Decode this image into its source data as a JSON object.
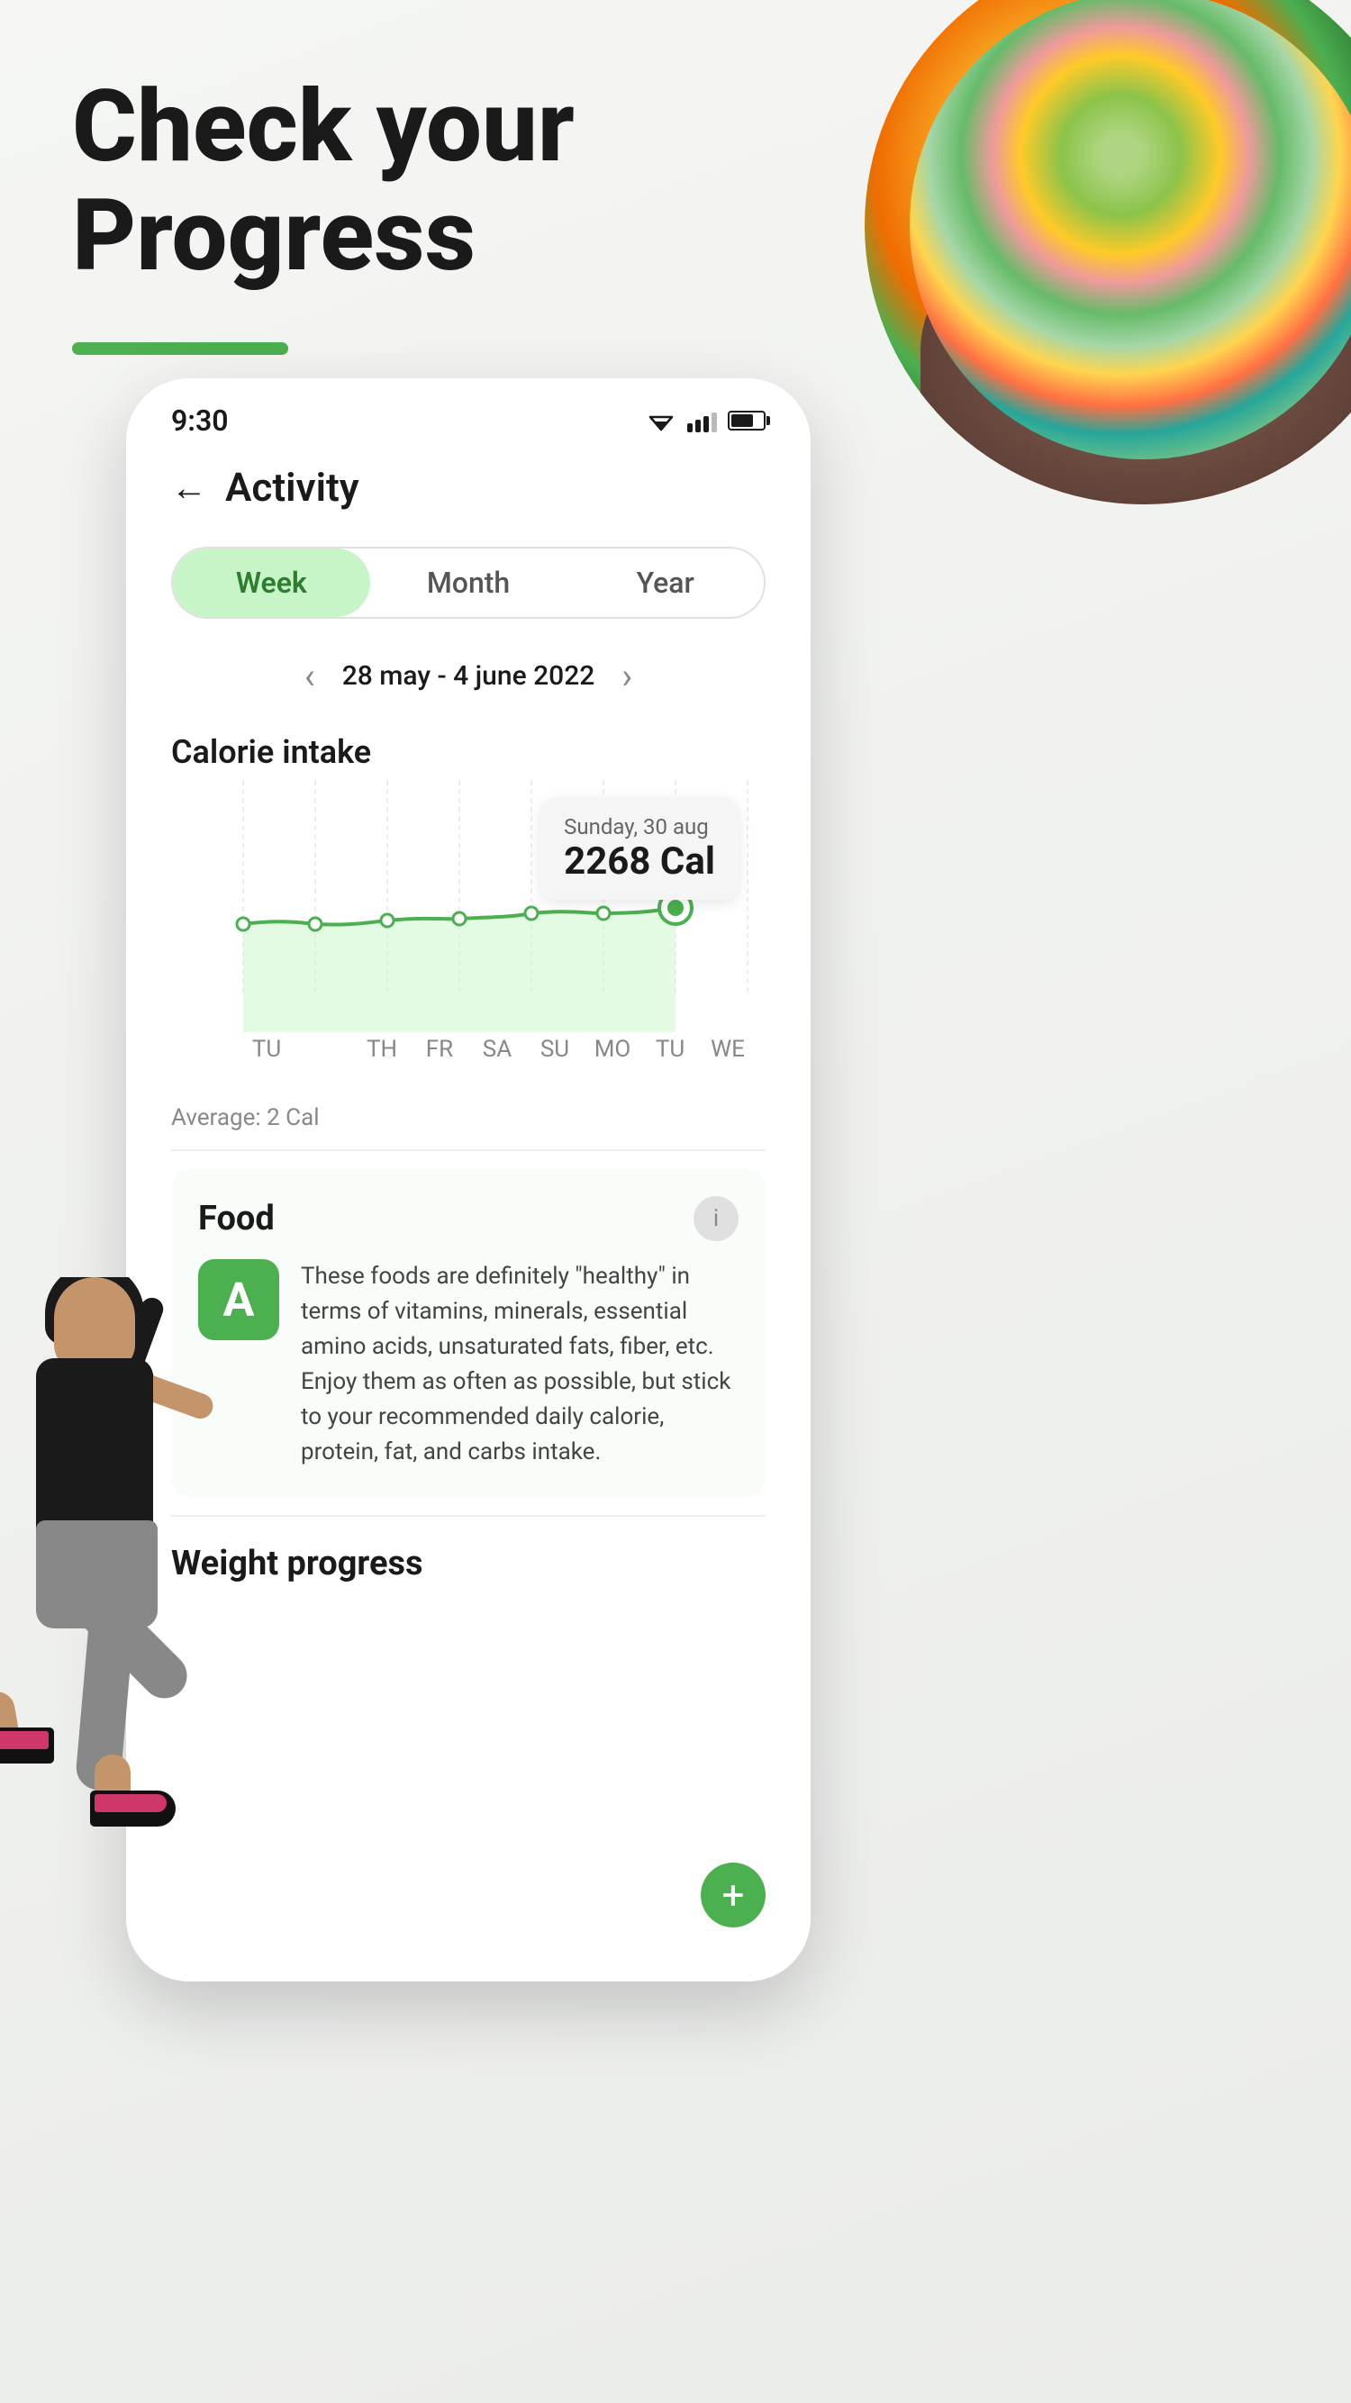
{
  "hero": {
    "title_line1": "Check your",
    "title_line2": "Progress",
    "underline_color": "#4caf50"
  },
  "status_bar": {
    "time": "9:30"
  },
  "nav": {
    "title": "Activity",
    "back_label": "←"
  },
  "tabs": [
    {
      "id": "week",
      "label": "Week",
      "active": true
    },
    {
      "id": "month",
      "label": "Month",
      "active": false
    },
    {
      "id": "year",
      "label": "Year",
      "active": false
    }
  ],
  "date_range": {
    "label": "28 may - 4 june 2022"
  },
  "chart": {
    "title": "Calorie intake",
    "tooltip": {
      "date": "Sunday, 30 aug",
      "value": "2268 Cal"
    },
    "x_labels": [
      "TU",
      "TH",
      "FR",
      "SA",
      "SU",
      "MO",
      "TU",
      "WE"
    ],
    "average_label": "Average: 2 Cal"
  },
  "food_section": {
    "title": "Food",
    "description": "These foods are definitely \"healthy\" in terms of vitamins, minerals, essential amino acids, unsaturated fats, fiber, etc. Enjoy them as often as possible, but stick to your recommended daily calorie, protein, fat, and carbs intake.",
    "badge_letter": "A"
  },
  "weight_section": {
    "title": "Weight progress",
    "plus_label": "+"
  },
  "icons": {
    "back": "←",
    "chevron_left": "‹",
    "chevron_right": "›",
    "info": "i",
    "plus": "+"
  }
}
